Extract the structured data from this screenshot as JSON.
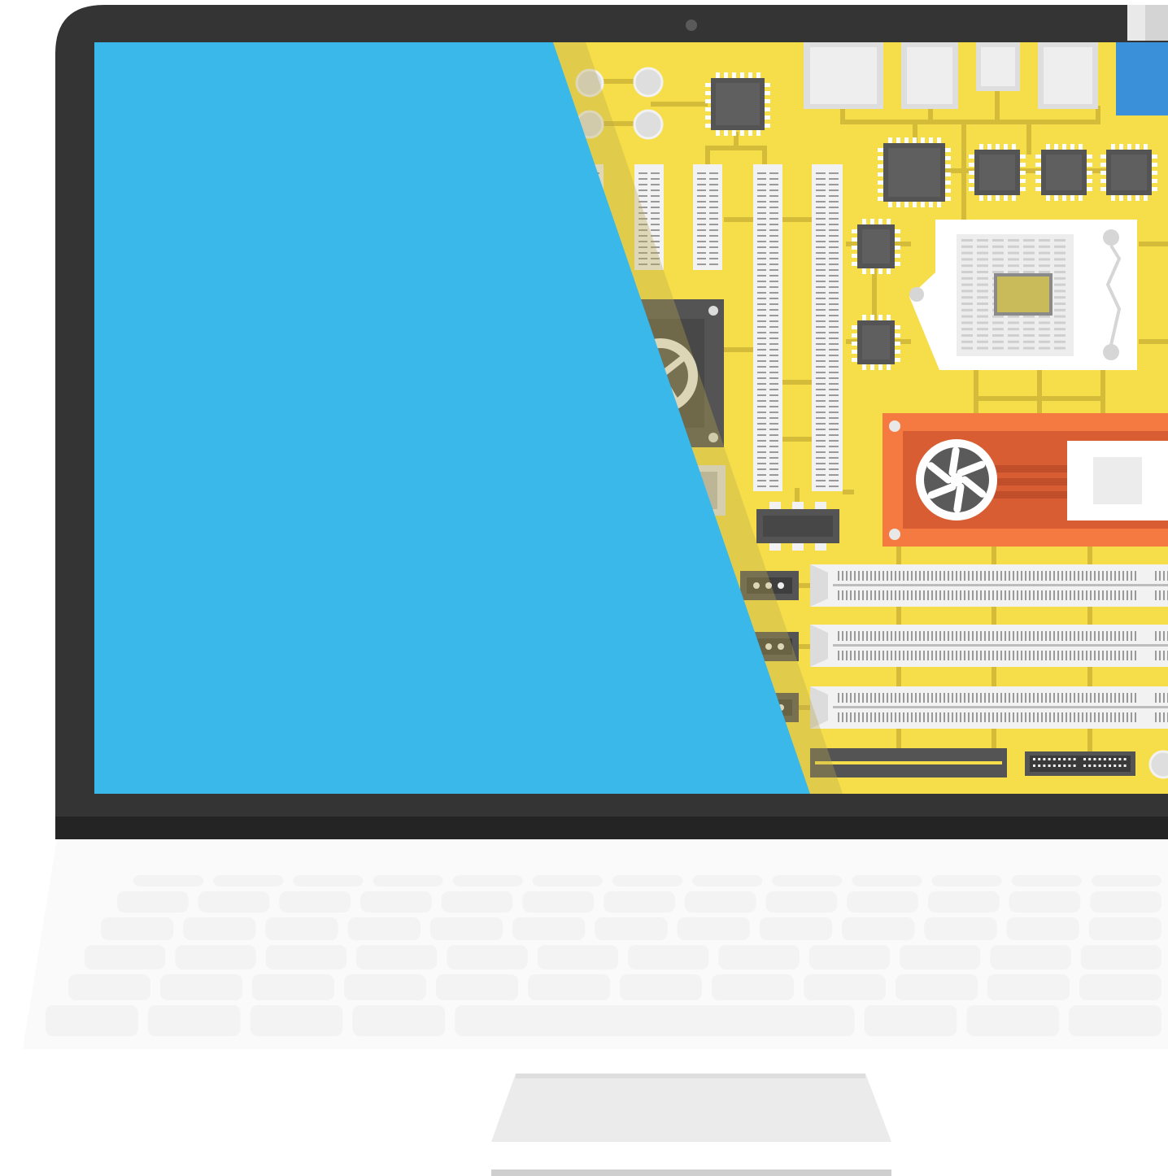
{
  "illustration": {
    "subject": "laptop-with-motherboard-screen",
    "colors": {
      "bezel": "#343434",
      "hinge": "#242424",
      "screen_blue": "#3bb8ea",
      "board_yellow": "#f6de4b",
      "trace": "#d4bb3a",
      "chip": "#545454",
      "slot_white": "#f2f2f2",
      "gpu_orange": "#f57a41",
      "gpu_inner": "#d95d33",
      "accent_blue": "#3b90da",
      "keyboard_key": "#f4f4f4",
      "keyboard_base": "#fafafa",
      "stand": "#ebebeb"
    },
    "icons": [
      "camera-icon",
      "fan-icon",
      "cpu-socket-icon",
      "gpu-icon"
    ]
  }
}
